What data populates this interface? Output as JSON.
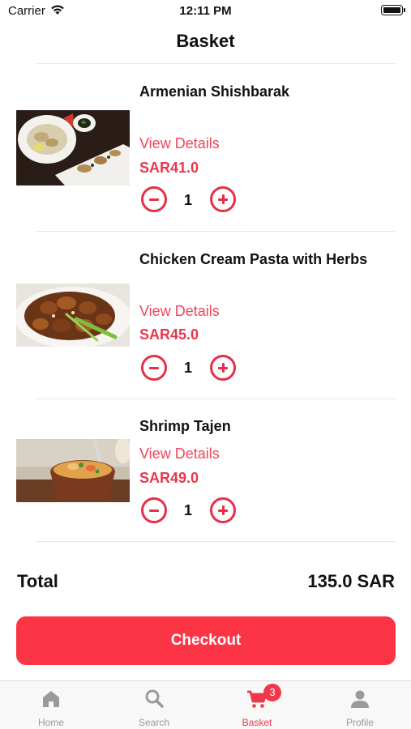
{
  "status_bar": {
    "carrier": "Carrier",
    "time": "12:11 PM"
  },
  "header": {
    "title": "Basket"
  },
  "items": [
    {
      "name": "Armenian Shishbarak",
      "view_details": "View Details",
      "price": "SAR41.0",
      "quantity": "1"
    },
    {
      "name": "Chicken Cream Pasta with Herbs",
      "view_details": "View Details",
      "price": "SAR45.0",
      "quantity": "1"
    },
    {
      "name": "Shrimp Tajen",
      "view_details": "View Details",
      "price": "SAR49.0",
      "quantity": "1"
    }
  ],
  "summary": {
    "total_label": "Total",
    "total_value": "135.0 SAR"
  },
  "checkout": {
    "label": "Checkout"
  },
  "tab_bar": {
    "tabs": [
      {
        "label": "Home",
        "icon": "home-icon"
      },
      {
        "label": "Search",
        "icon": "search-icon"
      },
      {
        "label": "Basket",
        "icon": "cart-icon",
        "badge": "3",
        "active": true
      },
      {
        "label": "Profile",
        "icon": "person-icon"
      }
    ]
  },
  "colors": {
    "accent": "#fb3545",
    "accent_text": "#e8384d",
    "tab_inactive": "#9a9a9a"
  }
}
